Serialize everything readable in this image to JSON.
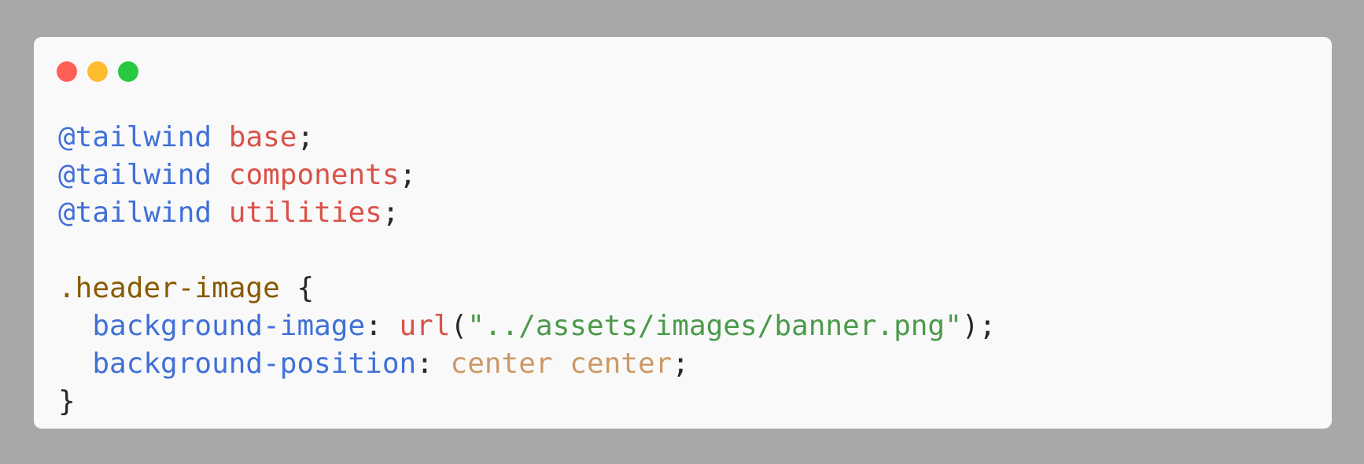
{
  "window": {
    "traffic_lights": [
      {
        "name": "close",
        "color": "#fe5f57"
      },
      {
        "name": "minimize",
        "color": "#febc2e"
      },
      {
        "name": "zoom",
        "color": "#28c840"
      }
    ]
  },
  "code": {
    "lines": [
      [
        {
          "t": "at",
          "v": "@tailwind"
        },
        {
          "t": "punc",
          "v": " "
        },
        {
          "t": "kw",
          "v": "base"
        },
        {
          "t": "punc",
          "v": ";"
        }
      ],
      [
        {
          "t": "at",
          "v": "@tailwind"
        },
        {
          "t": "punc",
          "v": " "
        },
        {
          "t": "kw",
          "v": "components"
        },
        {
          "t": "punc",
          "v": ";"
        }
      ],
      [
        {
          "t": "at",
          "v": "@tailwind"
        },
        {
          "t": "punc",
          "v": " "
        },
        {
          "t": "kw",
          "v": "utilities"
        },
        {
          "t": "punc",
          "v": ";"
        }
      ],
      [],
      [
        {
          "t": "sel",
          "v": ".header-image"
        },
        {
          "t": "punc",
          "v": " {"
        }
      ],
      [
        {
          "t": "punc",
          "v": "  "
        },
        {
          "t": "prop",
          "v": "background-image"
        },
        {
          "t": "punc",
          "v": ": "
        },
        {
          "t": "fn",
          "v": "url"
        },
        {
          "t": "punc",
          "v": "("
        },
        {
          "t": "str",
          "v": "\"../assets/images/banner.png\""
        },
        {
          "t": "punc",
          "v": ");"
        }
      ],
      [
        {
          "t": "punc",
          "v": "  "
        },
        {
          "t": "prop",
          "v": "background-position"
        },
        {
          "t": "punc",
          "v": ": "
        },
        {
          "t": "val",
          "v": "center"
        },
        {
          "t": "punc",
          "v": " "
        },
        {
          "t": "val",
          "v": "center"
        },
        {
          "t": "punc",
          "v": ";"
        }
      ],
      [
        {
          "t": "punc",
          "v": "}"
        }
      ]
    ]
  }
}
